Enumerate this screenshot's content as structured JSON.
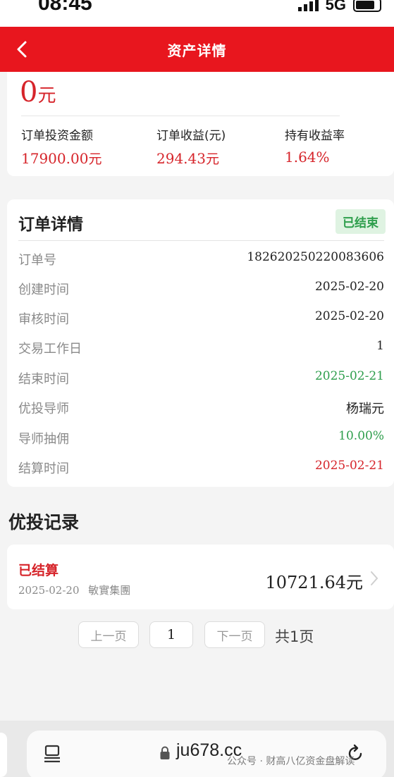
{
  "status_bar": {
    "time": "08:45",
    "network": "5G"
  },
  "nav": {
    "title": "资产详情"
  },
  "summary": {
    "balance": "0",
    "balance_unit": "元",
    "stats": [
      {
        "label": "订单投资金额",
        "value": "17900.00",
        "unit": "元"
      },
      {
        "label": "订单收益(元)",
        "value": "294.43",
        "unit": "元"
      },
      {
        "label": "持有收益率",
        "value": "1.64%",
        "unit": ""
      }
    ]
  },
  "order_detail": {
    "title": "订单详情",
    "status": "已结束",
    "rows": [
      {
        "label": "订单号",
        "value": "18262025022008360​6"
      },
      {
        "label": "创建时间",
        "value": "2025-02-20"
      },
      {
        "label": "审核时间",
        "value": "2025-02-20"
      },
      {
        "label": "交易工作日",
        "value": "1"
      },
      {
        "label": "结束时间",
        "value": "2025-02-21"
      },
      {
        "label": "优投导师",
        "value": "杨瑞元"
      },
      {
        "label": "导师抽佣",
        "value": "10.00%"
      },
      {
        "label": "结算时间",
        "value": "2025-02-21"
      }
    ]
  },
  "records": {
    "title": "优投记录",
    "items": [
      {
        "status": "已结算",
        "date": "2025-02-20",
        "company": "敏實集團",
        "amount": "10721.64",
        "unit": "元"
      }
    ]
  },
  "pagination": {
    "prev": "上一页",
    "current": "1",
    "next": "下一页",
    "total": "共1页"
  },
  "browser": {
    "url": "ju678.cc"
  },
  "watermark": "公众号 · 财高八亿资金盘解读",
  "colors": {
    "brand_red": "#e8161e",
    "value_red": "#d6242a",
    "green": "#2e9e4c"
  }
}
